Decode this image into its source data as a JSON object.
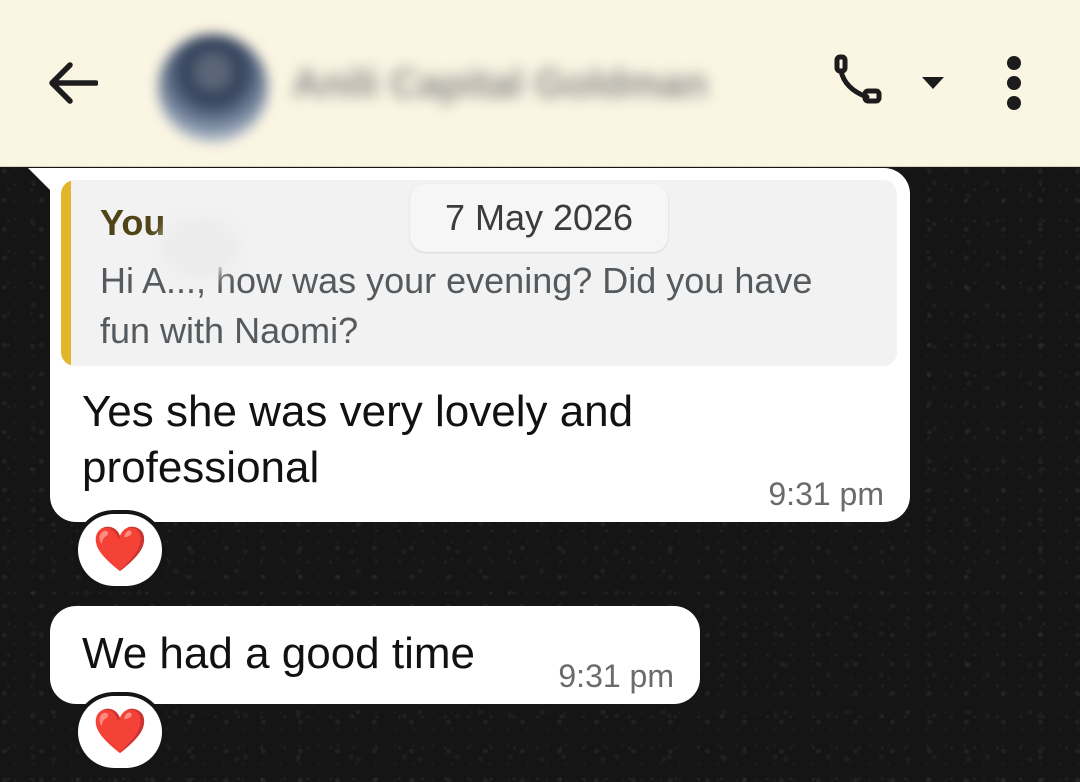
{
  "header": {
    "contact_name": "Anili Capital Goldman",
    "back_icon": "arrow-left-icon",
    "call_icon": "phone-icon",
    "caret_icon": "caret-down-icon",
    "menu_icon": "more-vertical-icon",
    "background_color": "#fbf5e3"
  },
  "date_chip": "7 May 2026",
  "messages": [
    {
      "quote": {
        "sender": "You",
        "text": "Hi A..., how was your evening? Did you have fun with Naomi?",
        "accent_color": "#e2b62a"
      },
      "text": "Yes she was very lovely and professional",
      "time": "9:31 pm",
      "reaction": "❤️"
    },
    {
      "text": "We had a good time",
      "time": "9:31 pm",
      "reaction": "❤️"
    }
  ],
  "colors": {
    "bubble": "#ffffff",
    "chat_background": "#151515",
    "reaction_heart": "#e0252e"
  }
}
